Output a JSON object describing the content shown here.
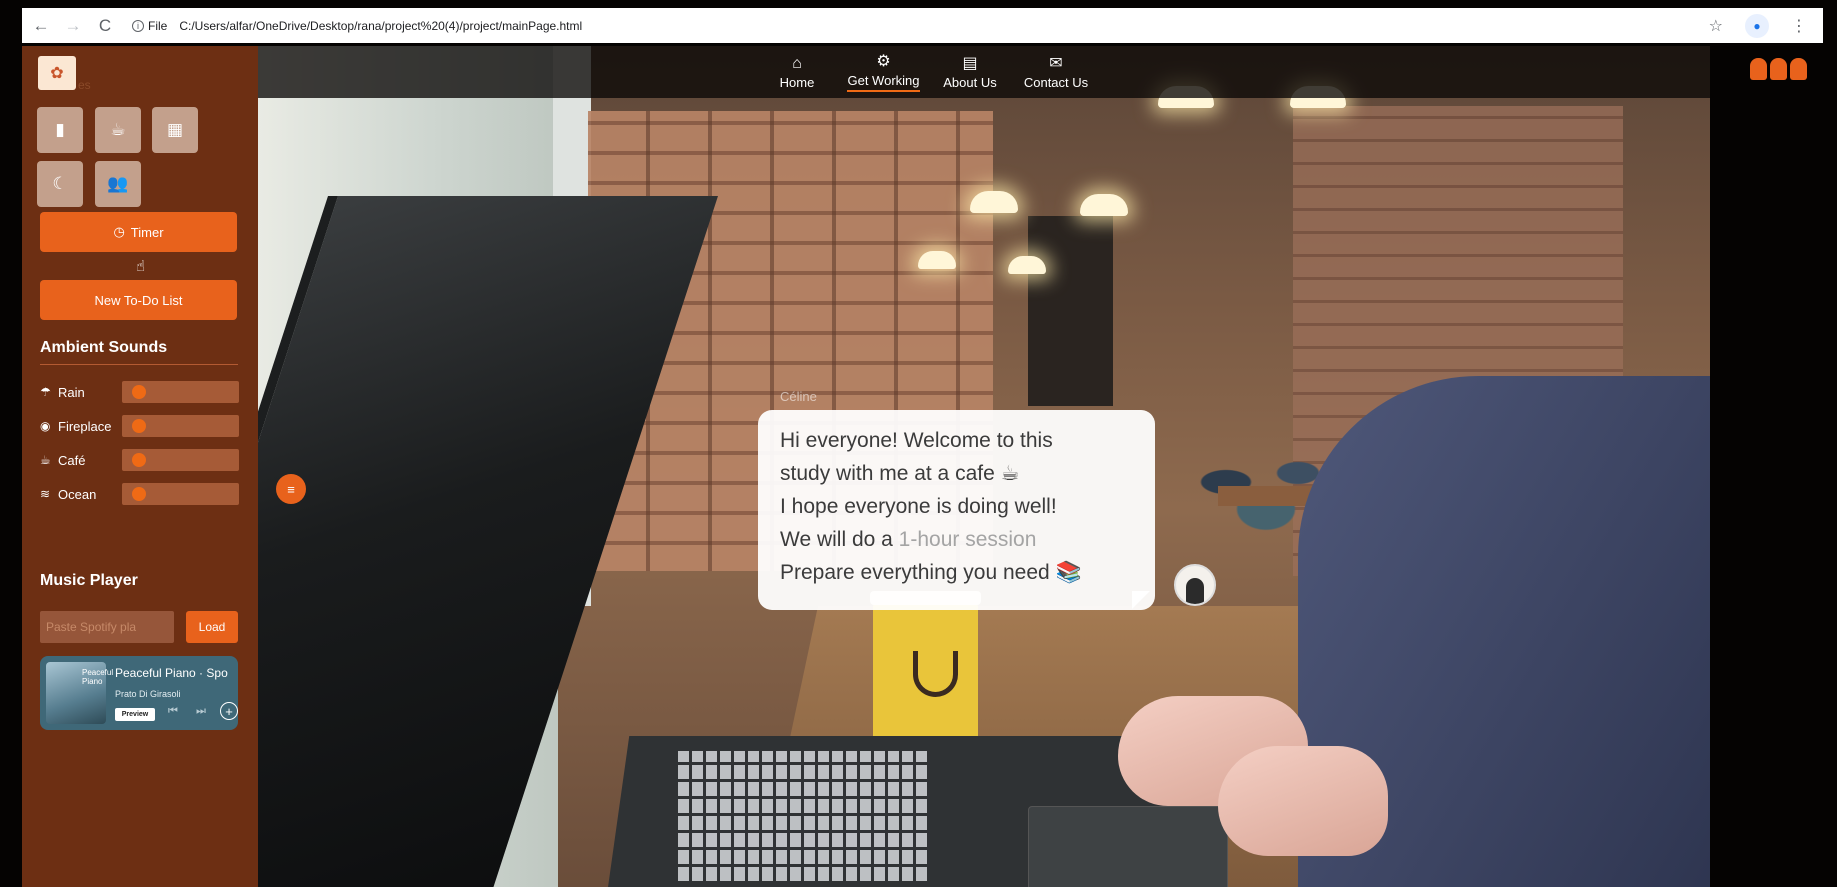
{
  "browser": {
    "nav_back": "←",
    "nav_forward": "→",
    "nav_reload": "C",
    "site_info": "File",
    "url": "C:/Users/alfar/OneDrive/Desktop/rana/project%20(4)/project/mainPage.html"
  },
  "topnav": {
    "items": [
      {
        "label": "Home",
        "icon": "home-icon"
      },
      {
        "label": "Get Working",
        "icon": "gear-icon",
        "active": true
      },
      {
        "label": "About Us",
        "icon": "book-icon"
      },
      {
        "label": "Contact Us",
        "icon": "envelope-icon"
      }
    ]
  },
  "sidebar": {
    "logo_text": "es",
    "tiles": [
      {
        "icon": "book-icon"
      },
      {
        "icon": "coffee-cup-icon"
      },
      {
        "icon": "city-icon"
      },
      {
        "icon": "moon-icon"
      },
      {
        "icon": "people-icon"
      }
    ],
    "timer_label": "Timer",
    "todo_label": "New To-Do List",
    "ambient_title": "Ambient Sounds",
    "sounds": [
      {
        "label": "Rain",
        "icon": "umbrella-icon",
        "level": 0
      },
      {
        "label": "Fireplace",
        "icon": "fire-icon",
        "level": 0
      },
      {
        "label": "Café",
        "icon": "coffee-cup-icon",
        "level": 0
      },
      {
        "label": "Ocean",
        "icon": "waves-icon",
        "level": 0
      }
    ],
    "music_title": "Music Player",
    "playlist_placeholder": "Paste Spotify pla",
    "load_label": "Load",
    "embed": {
      "cover_text": "Peaceful Piano",
      "title": "Peaceful Piano · Spo",
      "artist": "Prato Di Girasoli",
      "preview": "Preview"
    }
  },
  "bubble": {
    "name": "Céline",
    "line1": "Hi everyone! Welcome to this",
    "line2": "study with me at a cafe ☕",
    "line3": "I hope everyone is doing well!",
    "line4_a": "We will do a ",
    "line4_b": "1-hour session",
    "line5": "Prepare everything you need 📚"
  },
  "colors": {
    "accent": "#e8621c",
    "sidebar_bg": "#6d2f13"
  }
}
